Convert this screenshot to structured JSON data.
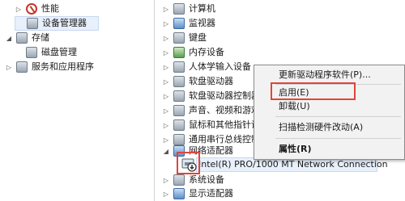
{
  "left_tree": [
    {
      "label": "性能",
      "icon": "performance-icon"
    },
    {
      "label": "设备管理器",
      "icon": "device-manager-icon"
    },
    {
      "label": "存储",
      "icon": "storage-icon"
    },
    {
      "label": "磁盘管理",
      "icon": "disk-icon"
    },
    {
      "label": "服务和应用程序",
      "icon": "services-icon"
    }
  ],
  "device_tree": [
    {
      "label": "计算机",
      "icon": "computer-icon"
    },
    {
      "label": "监视器",
      "icon": "monitor-icon"
    },
    {
      "label": "键盘",
      "icon": "keyboard-icon"
    },
    {
      "label": "内存设备",
      "icon": "memory-icon"
    },
    {
      "label": "人体学输入设备",
      "icon": "hid-icon"
    },
    {
      "label": "软盘驱动器",
      "icon": "floppy-icon"
    },
    {
      "label": "软盘驱动器控制器",
      "icon": "floppy-controller-icon"
    },
    {
      "label": "声音、视频和游戏控制器",
      "icon": "sound-icon"
    },
    {
      "label": "鼠标和其他指针设备",
      "icon": "mouse-icon"
    },
    {
      "label": "通用串行总线控制器",
      "icon": "usb-icon"
    },
    {
      "label": "网络适配器",
      "icon": "network-icon"
    },
    {
      "label": "Intel(R) PRO/1000 MT Network Connection",
      "icon": "nic-disabled-icon"
    },
    {
      "label": "系统设备",
      "icon": "system-icon"
    },
    {
      "label": "显示适配器",
      "icon": "display-icon"
    }
  ],
  "context_menu": {
    "update": "更新驱动程序软件(P)...",
    "enable": "启用(E)",
    "uninstall": "卸载(U)",
    "scan": "扫描检测硬件改动(A)",
    "properties": "属性(R)"
  },
  "colors": {
    "highlight": "#e0453a",
    "menu_bg": "#f2f2f2"
  }
}
